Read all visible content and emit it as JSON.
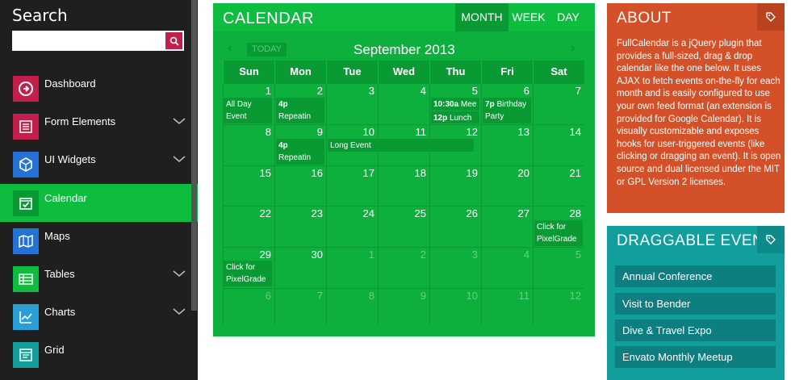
{
  "sidebar": {
    "search_title": "Search",
    "search_placeholder": "",
    "items": [
      {
        "label": "Dashboard",
        "icon": "arrow-right-circle-icon",
        "color": "#c41e4a",
        "chevron": false
      },
      {
        "label": "Form Elements",
        "icon": "list-icon",
        "color": "#c41e4a",
        "chevron": true
      },
      {
        "label": "UI Widgets",
        "icon": "cube-icon",
        "color": "#2572d6",
        "chevron": true
      },
      {
        "label": "Calendar",
        "icon": "calendar-check-icon",
        "color": "#0ebc40",
        "chevron": false,
        "active": true
      },
      {
        "label": "Maps",
        "icon": "map-icon",
        "color": "#2572d6",
        "chevron": false
      },
      {
        "label": "Tables",
        "icon": "table-icon",
        "color": "#0ebc40",
        "chevron": true
      },
      {
        "label": "Charts",
        "icon": "chart-icon",
        "color": "#2a9fd6",
        "chevron": true
      },
      {
        "label": "Grid",
        "icon": "grid-icon",
        "color": "#139e9e",
        "chevron": false
      }
    ]
  },
  "calendar": {
    "title": "CALENDAR",
    "views": {
      "month": "MONTH",
      "week": "WEEK",
      "day": "DAY"
    },
    "today_label": "TODAY",
    "month_label": "September 2013",
    "prev_icon": "‹",
    "next_icon": "›",
    "days_of_week": [
      "Sun",
      "Mon",
      "Tue",
      "Wed",
      "Thu",
      "Fri",
      "Sat"
    ],
    "weeks": [
      [
        "1",
        "2",
        "3",
        "4",
        "5",
        "6",
        "7"
      ],
      [
        "8",
        "9",
        "10",
        "11",
        "12",
        "13",
        "14"
      ],
      [
        "15",
        "16",
        "17",
        "18",
        "19",
        "20",
        "21"
      ],
      [
        "22",
        "23",
        "24",
        "25",
        "26",
        "27",
        "28"
      ],
      [
        "29",
        "30",
        "1",
        "2",
        "3",
        "4",
        "5"
      ],
      [
        "6",
        "7",
        "8",
        "9",
        "10",
        "11",
        "12"
      ]
    ],
    "events": {
      "all_day": "All Day Event",
      "repeating_1_time": "4p",
      "repeating_1_label": "Repeatin Event",
      "meeting_time": "10:30a",
      "meeting_label": "Mee",
      "lunch_time": "12p",
      "lunch_label": "Lunch",
      "birthday_time": "7p",
      "birthday_label": "Birthday Party",
      "repeating_2_time": "4p",
      "repeating_2_label": "Repeatin Event",
      "long_event": "Long Event",
      "click_1": "Click for PixelGrade",
      "click_2": "Click for PixelGrade"
    }
  },
  "about": {
    "title": "ABOUT",
    "text": "FullCalendar is a jQuery plugin that provides a full-sized, drag & drop calendar like the one below. It uses AJAX to fetch events on-the-fly for each month and is easily configured to use your own feed format (an extension is provided for Google Calendar). It is visually customizable and exposes hooks for user-triggered events (like clicking or dragging an event). It is open source and dual licensed under the MIT or GPL Version 2 licenses."
  },
  "draggable": {
    "title": "DRAGGABLE EVENTS",
    "items": [
      "Annual Conference",
      "Visit to Bender",
      "Dive & Travel Expo",
      "Envato Monthly Meetup"
    ]
  },
  "colors": {
    "sidebar_bg": "#1f1f1f",
    "calendar_green": "#0ebc40",
    "about_orange": "#d45029",
    "draggable_teal": "#139e9e"
  }
}
